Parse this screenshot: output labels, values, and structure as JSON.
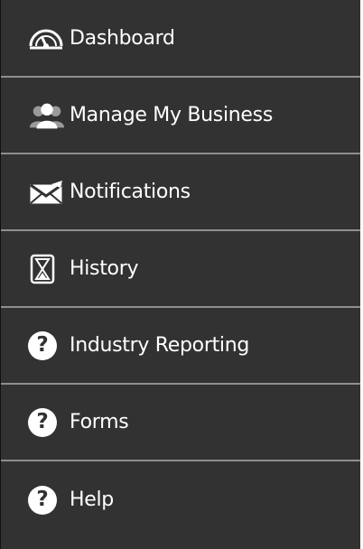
{
  "sidebar": {
    "items": [
      {
        "label": "Dashboard",
        "icon": "dashboard-gauge-icon"
      },
      {
        "label": "Manage My Business",
        "icon": "people-group-icon"
      },
      {
        "label": "Notifications",
        "icon": "envelope-icon"
      },
      {
        "label": "History",
        "icon": "hourglass-icon"
      },
      {
        "label": "Industry Reporting",
        "icon": "question-circle-icon"
      },
      {
        "label": "Forms",
        "icon": "question-circle-icon"
      },
      {
        "label": "Help",
        "icon": "question-circle-icon"
      }
    ],
    "colors": {
      "background": "#323232",
      "divider": "#8f8f8f",
      "text": "#ffffff"
    }
  }
}
